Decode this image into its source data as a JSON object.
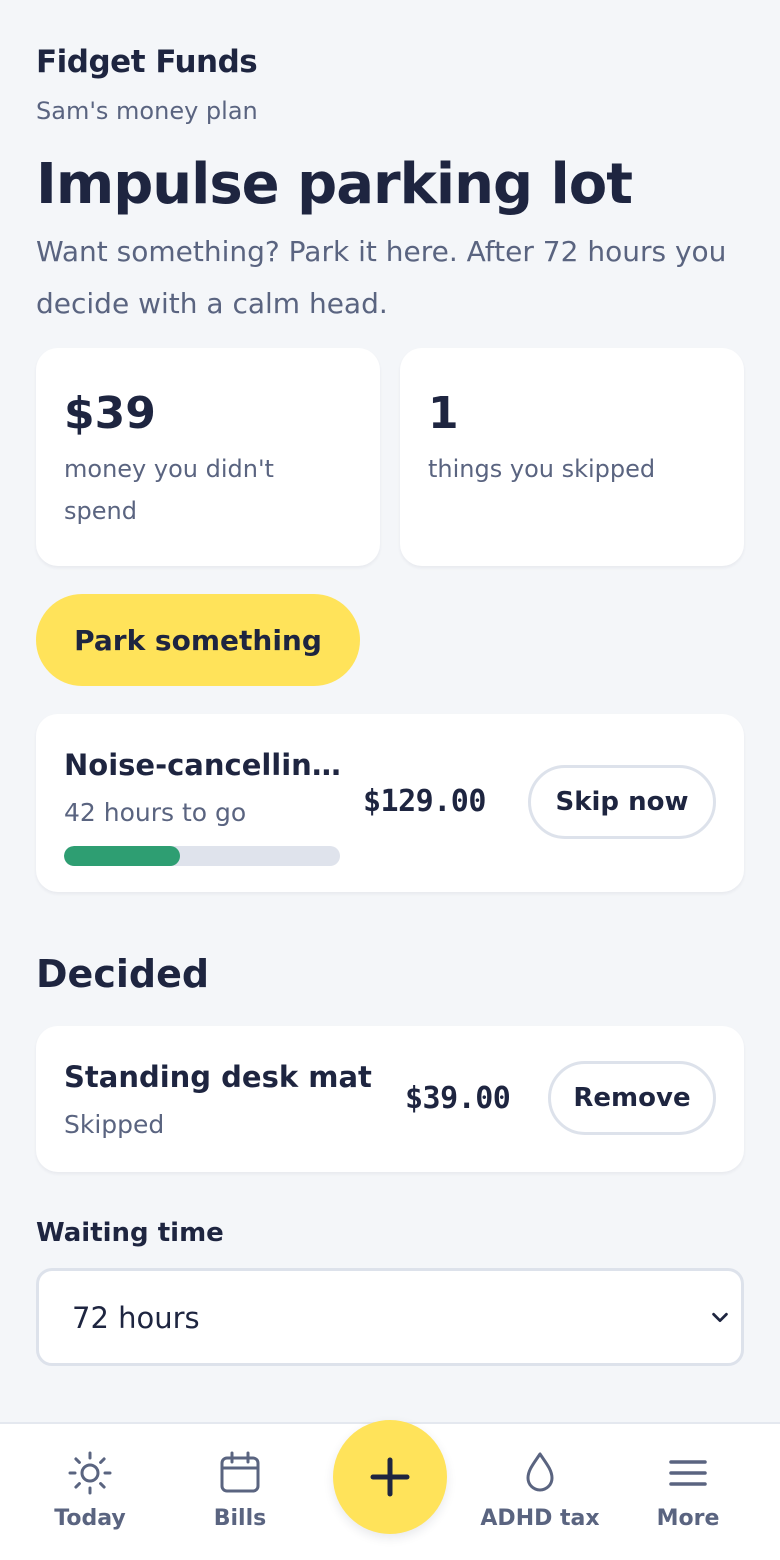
{
  "app": {
    "name": "Fidget Funds",
    "subtitle": "Sam's money plan"
  },
  "header": {
    "title": "Impulse parking lot",
    "description": "Want something? Park it here. After 72 hours you decide with a calm head."
  },
  "stats": [
    {
      "value": "$39",
      "label": "money you didn't spend"
    },
    {
      "value": "1",
      "label": "things you skipped"
    }
  ],
  "park_button": "Park something",
  "waiting_items": [
    {
      "name": "Noise-cancelling headphones",
      "status": "42 hours to go",
      "price": "$129.00",
      "action": "Skip now",
      "progress": 0.42
    }
  ],
  "decided_section": {
    "title": "Decided",
    "items": [
      {
        "name": "Standing desk mat",
        "status": "Skipped",
        "price": "$39.00",
        "action": "Remove"
      }
    ]
  },
  "waiting_time": {
    "label": "Waiting time",
    "selected": "72 hours"
  },
  "nav": {
    "items": [
      {
        "label": "Today",
        "icon": "sun-icon"
      },
      {
        "label": "Bills",
        "icon": "calendar-icon"
      },
      {
        "label": "ADHD tax",
        "icon": "drop-icon"
      },
      {
        "label": "More",
        "icon": "menu-icon"
      }
    ],
    "fab_icon": "plus-icon"
  },
  "colors": {
    "accent": "#ffe35a",
    "progress": "#2e9e72",
    "text": "#1e2540",
    "muted": "#5a6480",
    "background": "#f4f6f9"
  }
}
